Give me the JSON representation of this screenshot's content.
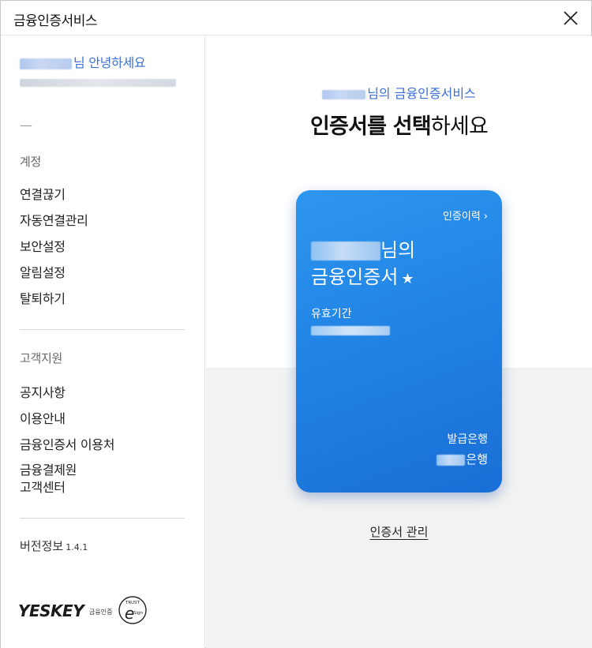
{
  "window": {
    "title": "금융인증서비스"
  },
  "sidebar": {
    "greeting_suffix": "님 안녕하세요",
    "dash": "—",
    "account_section": {
      "label": "계정",
      "items": [
        {
          "label": "연결끊기"
        },
        {
          "label": "자동연결관리"
        },
        {
          "label": "보안설정"
        },
        {
          "label": "알림설정"
        },
        {
          "label": "탈퇴하기"
        }
      ]
    },
    "support_section": {
      "label": "고객지원",
      "items": [
        {
          "label": "공지사항"
        },
        {
          "label": "이용안내"
        },
        {
          "label": "금융인증서 이용처"
        },
        {
          "label": "금융결제원\n고객센터"
        }
      ]
    },
    "version": {
      "label": "버전정보",
      "number": "1.4.1"
    },
    "logo": {
      "brand": "YESKEY",
      "sub": "금융인증",
      "badge_top": "TRUST",
      "badge_bottom": "Sign"
    }
  },
  "main": {
    "subtitle_suffix": "님의 금융인증서비스",
    "heading_bold": "인증서를 선택",
    "heading_rest": "하세요",
    "card": {
      "history_label": "인증이력",
      "history_chevron": "›",
      "owner_suffix": "님의",
      "cert_name": "금융인증서",
      "star": "★",
      "valid_label": "유효기간",
      "issuer_label": "발급은행",
      "issuer_suffix": "은행"
    },
    "manage_link": "인증서 관리"
  },
  "colors": {
    "accent": "#3b6fd8",
    "card_blue": "#2189e8",
    "lower_bg": "#f2f2f2"
  }
}
